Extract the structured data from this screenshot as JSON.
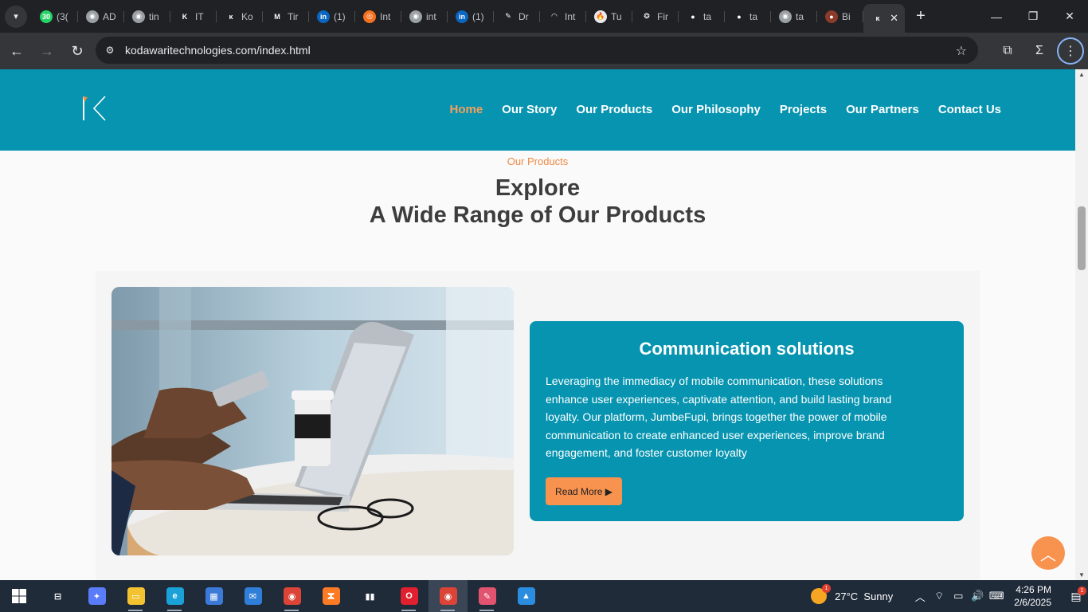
{
  "browser": {
    "tabs": [
      {
        "title": "(3(",
        "icon": "whatsapp-icon",
        "color": "#25d366",
        "glyph": "30"
      },
      {
        "title": "AD",
        "icon": "globe-icon",
        "color": "#9aa0a6",
        "glyph": "◉"
      },
      {
        "title": "tin",
        "icon": "globe-icon",
        "color": "#9aa0a6",
        "glyph": "◉"
      },
      {
        "title": "IT",
        "icon": "k-logo-icon",
        "color": "#202124",
        "glyph": "K"
      },
      {
        "title": "Ko",
        "icon": "kodawari-icon",
        "color": "#202124",
        "glyph": "ĸ"
      },
      {
        "title": "Tir",
        "icon": "gmail-icon",
        "color": "#202124",
        "glyph": "M"
      },
      {
        "title": "(1)",
        "icon": "linkedin-icon",
        "color": "#0a66c2",
        "glyph": "in"
      },
      {
        "title": "Int",
        "icon": "lifebuoy-icon",
        "color": "#f4711f",
        "glyph": "◎"
      },
      {
        "title": "int",
        "icon": "globe-icon",
        "color": "#9aa0a6",
        "glyph": "◉"
      },
      {
        "title": "(1)",
        "icon": "linkedin-icon",
        "color": "#0a66c2",
        "glyph": "in"
      },
      {
        "title": "Dr",
        "icon": "draw-icon",
        "color": "#202124",
        "glyph": "✎"
      },
      {
        "title": "Int",
        "icon": "gauge-icon",
        "color": "#202124",
        "glyph": "◠"
      },
      {
        "title": "Tu",
        "icon": "fire-icon",
        "color": "#e8eaed",
        "glyph": "🔥"
      },
      {
        "title": "Fir",
        "icon": "openai-icon",
        "color": "#202124",
        "glyph": "❂"
      },
      {
        "title": "ta",
        "icon": "github-icon",
        "color": "#202124",
        "glyph": "●"
      },
      {
        "title": "ta",
        "icon": "github-icon",
        "color": "#202124",
        "glyph": "●"
      },
      {
        "title": "ta",
        "icon": "globe-icon",
        "color": "#9aa0a6",
        "glyph": "◉"
      },
      {
        "title": "Bi",
        "icon": "avatar-icon",
        "color": "#8a3b2a",
        "glyph": "●"
      },
      {
        "title": "",
        "icon": "kodawari-icon",
        "color": "#35363a",
        "glyph": "ĸ",
        "active": true
      }
    ],
    "url": "kodawaritechnologies.com/index.html"
  },
  "site": {
    "nav": [
      "Home",
      "Our Story",
      "Our Products",
      "Our Philosophy",
      "Projects",
      "Our Partners",
      "Contact Us"
    ],
    "eyebrow": "Our Products",
    "heading_line1": "Explore",
    "heading_line2": "A Wide Range of Our Products",
    "card": {
      "title": "Communication solutions",
      "text": "Leveraging the immediacy of mobile communication, these solutions enhance user experiences, captivate attention, and build lasting brand loyalty. Our platform, JumbeFupi, brings together the power of mobile communication to create enhanced user experiences, improve brand engagement, and foster customer loyalty",
      "button": "Read More ▶"
    }
  },
  "taskbar": {
    "apps": [
      {
        "name": "task-view-icon",
        "color": "#202b3a",
        "glyph": "⊟"
      },
      {
        "name": "copilot-icon",
        "color": "#5b7cfa",
        "glyph": "✦"
      },
      {
        "name": "file-explorer-icon",
        "color": "#f2c230",
        "glyph": "▭"
      },
      {
        "name": "edge-icon",
        "color": "#1aa1d8",
        "glyph": "e"
      },
      {
        "name": "store-icon",
        "color": "#3b7ad9",
        "glyph": "▦"
      },
      {
        "name": "mail-icon",
        "color": "#2f7ed8",
        "glyph": "✉"
      },
      {
        "name": "chrome-icon",
        "color": "#db4437",
        "glyph": "◉"
      },
      {
        "name": "xampp-icon",
        "color": "#fb7a24",
        "glyph": "ⵣ"
      },
      {
        "name": "audio-app-icon",
        "color": "#202b3a",
        "glyph": "▮▮"
      },
      {
        "name": "opera-icon",
        "color": "#e0202e",
        "glyph": "O"
      },
      {
        "name": "chrome-profile-icon",
        "color": "#db4437",
        "glyph": "◉"
      },
      {
        "name": "paint-icon",
        "color": "#e2536f",
        "glyph": "✎"
      },
      {
        "name": "photos-icon",
        "color": "#2a8de0",
        "glyph": "▲"
      }
    ],
    "weather": {
      "temp": "27°C",
      "condition": "Sunny",
      "badge": "1"
    },
    "time": "4:26 PM",
    "date": "2/6/2025",
    "notifications": "1"
  }
}
